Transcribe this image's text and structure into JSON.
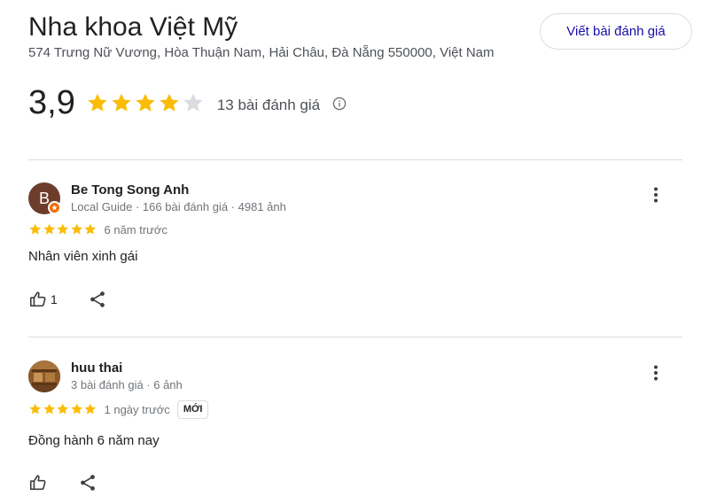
{
  "place": {
    "name": "Nha khoa Việt Mỹ",
    "address": "574 Trưng Nữ Vương, Hòa Thuận Nam, Hải Châu, Đà Nẵng 550000, Việt Nam",
    "write_review_label": "Viết bài đánh giá"
  },
  "summary": {
    "rating": "3,9",
    "stars_filled": 4,
    "stars_total": 5,
    "review_count": "13 bài đánh giá",
    "info_icon": "info-icon"
  },
  "colors": {
    "star_filled": "#fbbc04",
    "star_empty": "#dadce0",
    "link": "#1a0dab",
    "divider": "#dadce0"
  },
  "reviews": [
    {
      "author": "Be Tong Song Anh",
      "avatar_letter": "B",
      "meta": "Local Guide · 166 bài đánh giá · 4981 ảnh",
      "stars": 5,
      "time": "6 năm trước",
      "badge": "",
      "text": "Nhân viên xinh gái",
      "likes": "1"
    },
    {
      "author": "huu thai",
      "avatar_letter": "",
      "meta": "3 bài đánh giá · 6 ảnh",
      "stars": 5,
      "time": "1 ngày trước",
      "badge": "MỚI",
      "text": "Đồng hành 6 năm nay",
      "likes": ""
    }
  ]
}
